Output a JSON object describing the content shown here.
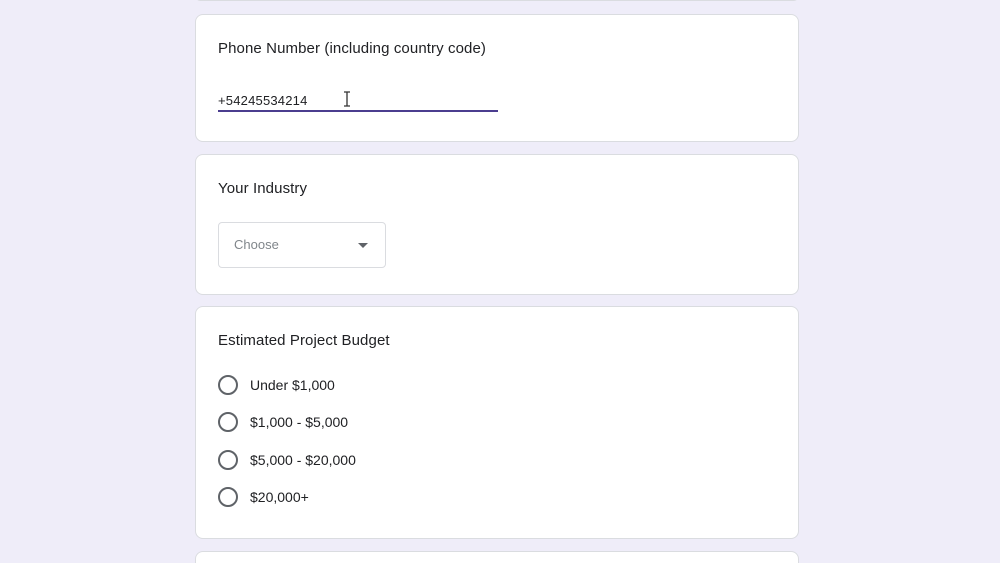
{
  "phone_question": {
    "title": "Phone Number (including country code)",
    "value": "+54245534214"
  },
  "industry_question": {
    "title": "Your Industry",
    "selected": "Choose",
    "caret_icon": "arrow-drop-down-icon"
  },
  "budget_question": {
    "title": "Estimated Project Budget",
    "options": [
      {
        "label": "Under $1,000",
        "selected": false
      },
      {
        "label": "$1,000 - $5,000",
        "selected": false
      },
      {
        "label": "$5,000 - $20,000",
        "selected": false
      },
      {
        "label": "$20,000+",
        "selected": false
      }
    ]
  },
  "colors": {
    "page_background": "#efedf9",
    "accent": "#4b3d8f",
    "card": "#ffffff",
    "text": "#202124",
    "placeholder": "#80868b"
  }
}
